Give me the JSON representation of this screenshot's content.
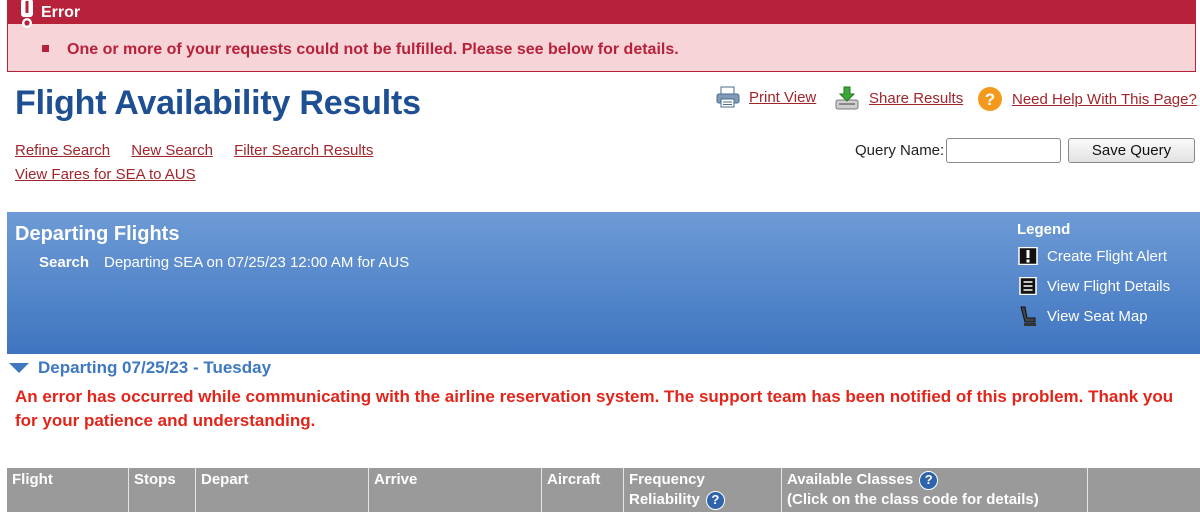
{
  "error": {
    "title": "Error",
    "message": "One or more of your requests could not be fulfilled. Please see below for details."
  },
  "page_title": "Flight Availability Results",
  "tools": {
    "print_view": "Print View",
    "share_results": "Share Results",
    "need_help": "Need Help With This Page?"
  },
  "nav": {
    "refine_search": "Refine Search",
    "new_search": "New Search",
    "filter_results": "Filter Search Results",
    "view_fares": "View Fares for SEA to AUS"
  },
  "query": {
    "label": "Query Name:",
    "value": "",
    "save_label": "Save Query"
  },
  "panel": {
    "title": "Departing Flights",
    "search_label": "Search",
    "search_text": "Departing SEA on 07/25/23 12:00 AM for AUS"
  },
  "legend": {
    "title": "Legend",
    "items": [
      {
        "label": "Create Flight Alert",
        "icon": "alert-icon"
      },
      {
        "label": "View Flight Details",
        "icon": "details-icon"
      },
      {
        "label": "View Seat Map",
        "icon": "seat-icon"
      }
    ]
  },
  "departing": {
    "header": "Departing 07/25/23 - Tuesday",
    "error_text": "An error has occurred while communicating with the airline reservation system. The support team has been notified of this problem. Thank you for your patience and understanding."
  },
  "table": {
    "columns": {
      "flight": "Flight",
      "stops": "Stops",
      "depart": "Depart",
      "arrive": "Arrive",
      "aircraft": "Aircraft",
      "frequency_1": "Frequency",
      "frequency_2": "Reliability",
      "classes_1": "Available Classes",
      "classes_2": "(Click on the class code for details)"
    },
    "help_glyph": "?"
  },
  "colors": {
    "error_red": "#b8213a",
    "error_bg": "#f6d4d7",
    "title_blue": "#1f4f93",
    "link_red": "#a0262c",
    "panel_blue": "#4a7fc6",
    "alert_text": "#e1251b",
    "table_header": "#9a9a9a"
  }
}
